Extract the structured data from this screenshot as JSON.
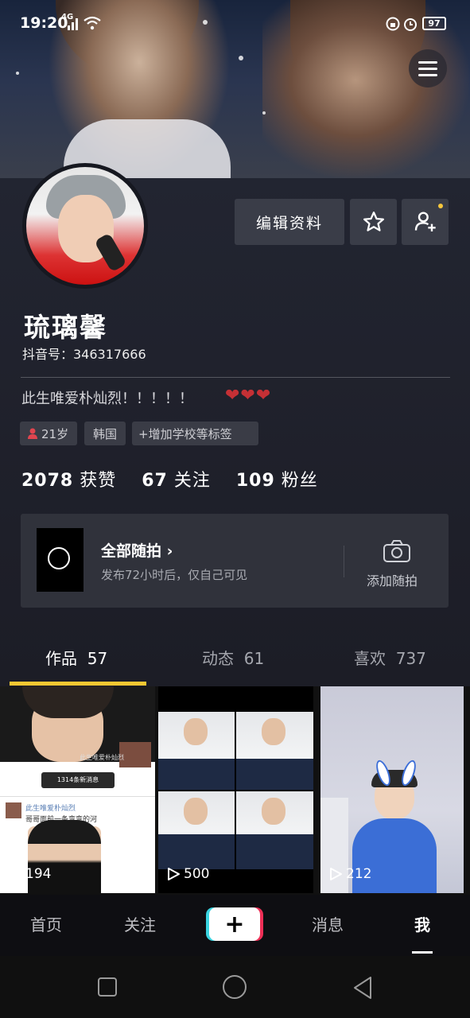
{
  "status_bar": {
    "time": "19:20",
    "network": "4G",
    "battery": "97"
  },
  "profile": {
    "name": "琉璃馨",
    "douyin_id": "抖音号：346317666",
    "bio": "此生唯爱朴灿烈！！！！！",
    "bio_hearts": "❤❤❤",
    "tags": {
      "age": "21岁",
      "location": "韩国",
      "school": "+增加学校等标签"
    }
  },
  "buttons": {
    "edit_profile": "编辑资料"
  },
  "stats": {
    "likes": "2078",
    "likes_label": "获赞",
    "following": "67",
    "following_label": "关注",
    "followers": "109",
    "followers_label": "粉丝"
  },
  "moments": {
    "title": "全部随拍 ›",
    "subtitle": "发布72小时后，仅自己可见",
    "add_label": "添加随拍"
  },
  "tabs": [
    {
      "label": "作品",
      "count": "57"
    },
    {
      "label": "动态",
      "count": "61"
    },
    {
      "label": "喜欢",
      "count": "737"
    }
  ],
  "videos": [
    {
      "plays": "194",
      "caption_top": "此生唯爱朴灿烈",
      "caption_chip": "1314条新消息",
      "caption_user": "此生唯爱朴灿烈",
      "caption_text": "哥哥面前一条弯弯的河"
    },
    {
      "plays": "500"
    },
    {
      "plays": "212"
    }
  ],
  "bottom_nav": {
    "home": "首页",
    "following": "关注",
    "add": "+",
    "messages": "消息",
    "me": "我"
  },
  "colors": {
    "accent": "#f7c832",
    "panel": "#222531",
    "heart": "#c53035"
  }
}
